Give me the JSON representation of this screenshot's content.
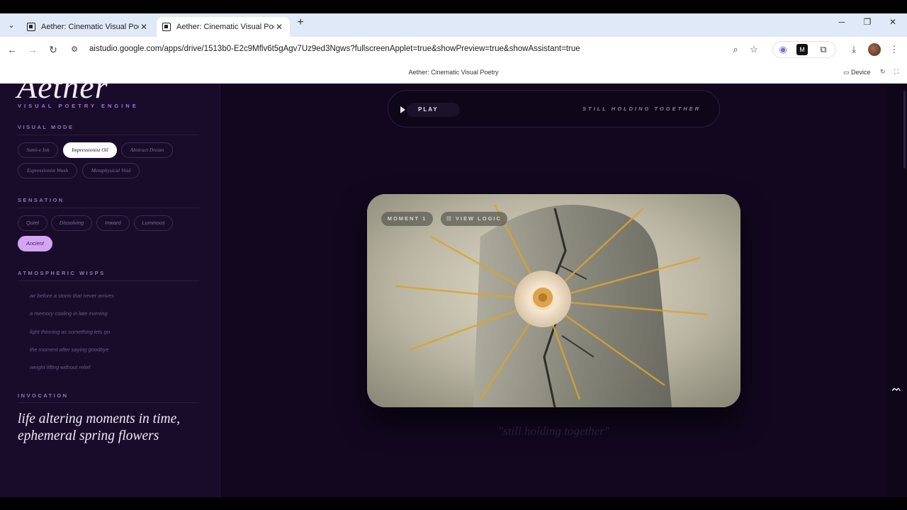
{
  "browser": {
    "tabs": [
      {
        "title": "Aether: Cinematic Visual Poetr",
        "active": false
      },
      {
        "title": "Aether: Cinematic Visual Poetr",
        "active": true
      }
    ],
    "url": "aistudio.google.com/apps/drive/1513b0-E2c9Mflv6t5gAgv7Uz9ed3Ngws?fullscreenApplet=true&showPreview=true&showAssistant=true"
  },
  "studio": {
    "title": "Aether: Cinematic Visual Poetry",
    "device_label": "Device"
  },
  "sidebar": {
    "logo": "Aether",
    "logo_sub": "VISUAL POETRY ENGINE",
    "visual_mode": {
      "heading": "VISUAL MODE",
      "chips": [
        "Sumi-e Ink",
        "Impressionist Oil",
        "Abstract Dream",
        "Expressionist Wash",
        "Metaphysical Void"
      ],
      "selected": "Impressionist Oil"
    },
    "sensation": {
      "heading": "SENSATION",
      "chips": [
        "Quiet",
        "Dissolving",
        "Inward",
        "Luminous",
        "Ancient"
      ],
      "selected": "Ancient"
    },
    "wisps": {
      "heading": "ATMOSPHERIC WISPS",
      "items": [
        "air before a storm that never arrives",
        "a memory cooling in late evening",
        "light thinning as something lets go",
        "the moment after saying goodbye",
        "weight lifting without relief"
      ]
    },
    "invocation": {
      "heading": "INVOCATION",
      "text": "life altering moments in time, ephemeral spring flowers"
    }
  },
  "player": {
    "play_label": "PLAY",
    "now_playing": "STILL HOLDING TOGETHER"
  },
  "card": {
    "moment_label": "MOMENT 1",
    "view_logic_label": "VIEW LOGIC"
  },
  "caption": "\"still holding together\"",
  "colors": {
    "sidebar_bg": "#190c2b",
    "main_bg": "#12071f",
    "accent_purple": "#d3a5f2",
    "logo_sub": "#9b77d6"
  }
}
